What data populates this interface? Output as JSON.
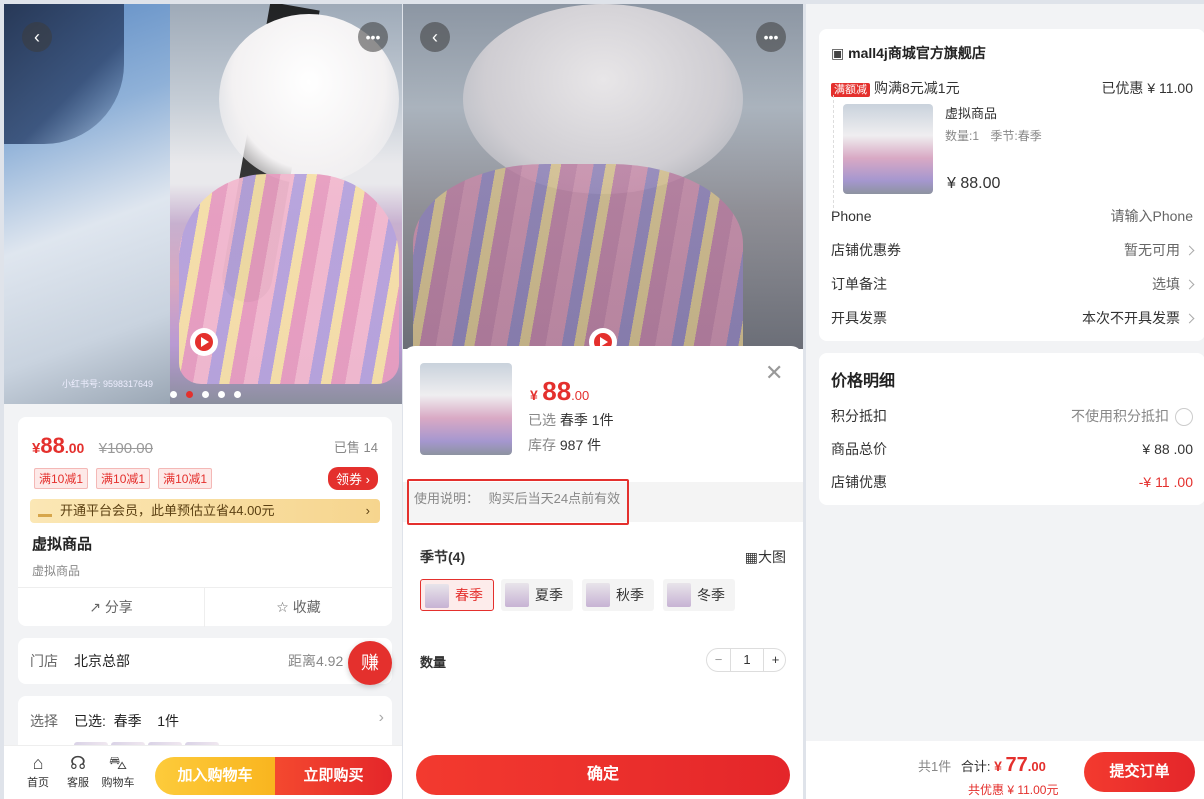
{
  "detail": {
    "watermark": "小红书号: 9598317649",
    "price_symbol": "¥",
    "price": "88",
    "price_decimal": ".00",
    "original_price": "¥100.00",
    "sold": "已售 14",
    "promo_tags": [
      "满10减1",
      "满10减1",
      "满10减1"
    ],
    "coupon_label": "领券",
    "vip_text": "开通平台会员，此单预估立省44.00元",
    "product_name": "虚拟商品",
    "product_subtitle": "虚拟商品",
    "share_label": "分享",
    "favorite_label": "收藏",
    "store_label": "门店",
    "store_name": "北京总部",
    "store_distance": "距离4.92",
    "earn_label": "赚",
    "select_label": "选择",
    "select_value": "已选:  春季    1件",
    "tabs": [
      {
        "label": "首页",
        "icon": "home-icon"
      },
      {
        "label": "客服",
        "icon": "headset-icon"
      },
      {
        "label": "购物车",
        "icon": "cart-icon"
      }
    ],
    "add_cart_label": "加入购物车",
    "buy_now_label": "立即购买"
  },
  "sku": {
    "price_symbol": "¥",
    "price": "88",
    "price_decimal": ".00",
    "selected_label": "已选",
    "selected_value": "春季 1件",
    "stock_label": "库存",
    "stock_value": "987 件",
    "usage_label": "使用说明：",
    "usage_text": "购买后当天24点前有效",
    "spec_title": "季节(4)",
    "big_image_label": "大图",
    "options": [
      "春季",
      "夏季",
      "秋季",
      "冬季"
    ],
    "selected_option": "春季",
    "quantity_label": "数量",
    "quantity": "1",
    "confirm_label": "确定"
  },
  "order": {
    "store_name": "mall4j商城官方旗舰店",
    "promo_tag": "满额减",
    "promo_text": "购满8元减1元",
    "promo_discount": "已优惠 ¥ 11.00",
    "item_name": "虚拟商品",
    "item_qty": "数量:1",
    "item_spec": "季节:春季",
    "item_price": "¥ 88.00",
    "phone_label": "Phone",
    "phone_placeholder": "请输入Phone",
    "coupon_label": "店铺优惠券",
    "coupon_value": "暂无可用",
    "remark_label": "订单备注",
    "remark_value": "选填",
    "invoice_label": "开具发票",
    "invoice_value": "本次不开具发票",
    "detail_title": "价格明细",
    "points_label": "积分抵扣",
    "points_value": "不使用积分抵扣",
    "total_label": "商品总价",
    "total_value": "¥ 88 .00",
    "shop_discount_label": "店铺优惠",
    "shop_discount_value": "-¥ 11 .00",
    "count_text": "共1件",
    "sum_label": "合计:",
    "sum_symbol": "¥",
    "sum_int": "77",
    "sum_dec": ".00",
    "saved_text": "共优惠 ¥ 11.00元",
    "submit_label": "提交订单"
  },
  "colors": {
    "accent": "#e4302d",
    "cart": "#fdcb3b"
  }
}
